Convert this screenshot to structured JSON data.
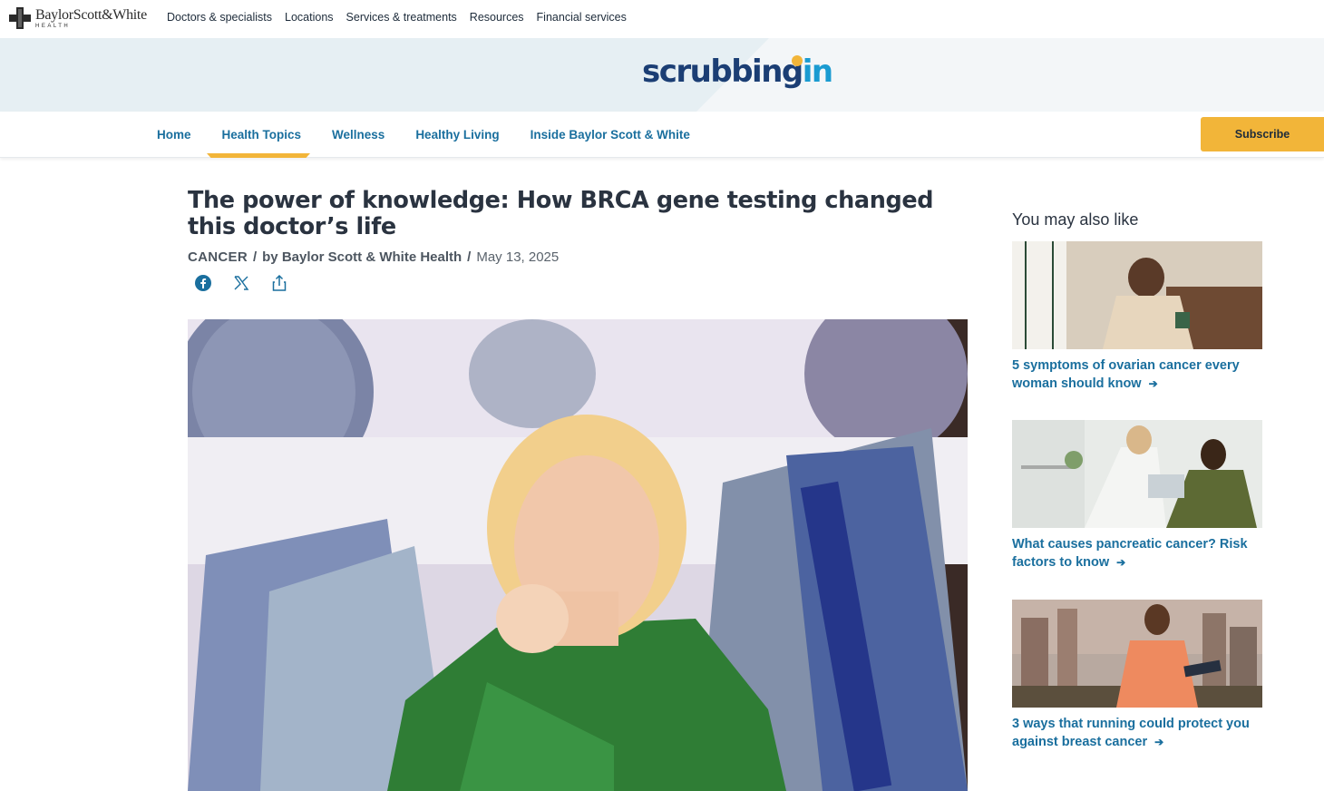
{
  "top": {
    "logo_name": "BaylorScott&White",
    "logo_sub": "HEALTH",
    "nav": [
      "Doctors & specialists",
      "Locations",
      "Services & treatments",
      "Resources",
      "Financial services"
    ]
  },
  "banner": {
    "brand_part1": "scrubbing",
    "brand_part2": "in"
  },
  "subnav": {
    "items": [
      "Home",
      "Health Topics",
      "Wellness",
      "Healthy Living",
      "Inside Baylor Scott & White"
    ],
    "active": "Health Topics",
    "subscribe_label": "Subscribe"
  },
  "article": {
    "title": "The power of knowledge: How BRCA gene testing changed this doctor’s life",
    "category": "CANCER",
    "separator": "/",
    "byline": "by Baylor Scott & White Health",
    "date": "May 13, 2025",
    "share_icons": [
      "facebook-icon",
      "x-icon",
      "share-icon"
    ]
  },
  "sidebar": {
    "heading": "You may also like",
    "cards": [
      {
        "label": "5 symptoms of ovarian cancer every woman should know"
      },
      {
        "label": "What causes pancreatic cancer? Risk factors to know"
      },
      {
        "label": "3 ways that running could protect you against breast cancer"
      }
    ],
    "arrow": "➔"
  },
  "colors": {
    "accent_yellow": "#f2b539",
    "link_blue": "#1a6f9e",
    "brand_navy": "#1b3e74",
    "brand_blue": "#1a9bd1"
  }
}
